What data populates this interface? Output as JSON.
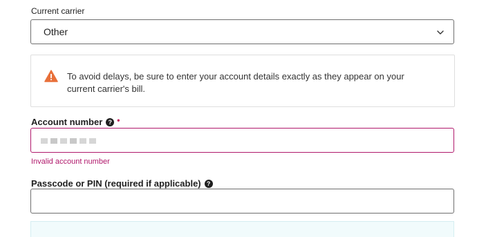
{
  "carrier": {
    "label": "Current carrier",
    "selected": "Other"
  },
  "notice": {
    "icon": "warning-icon",
    "text": "To avoid delays, be sure to enter your account details exactly as they appear on your current carrier's bill.",
    "icon_color": "#e8703a"
  },
  "account_number": {
    "label": "Account number",
    "help_glyph": "?",
    "required_mark": "•",
    "error": "Invalid account number"
  },
  "passcode": {
    "label": "Passcode or PIN (required if applicable)",
    "help_glyph": "?",
    "value": ""
  },
  "colors": {
    "error": "#b0186b",
    "panel_bg": "#f1fbfc"
  }
}
